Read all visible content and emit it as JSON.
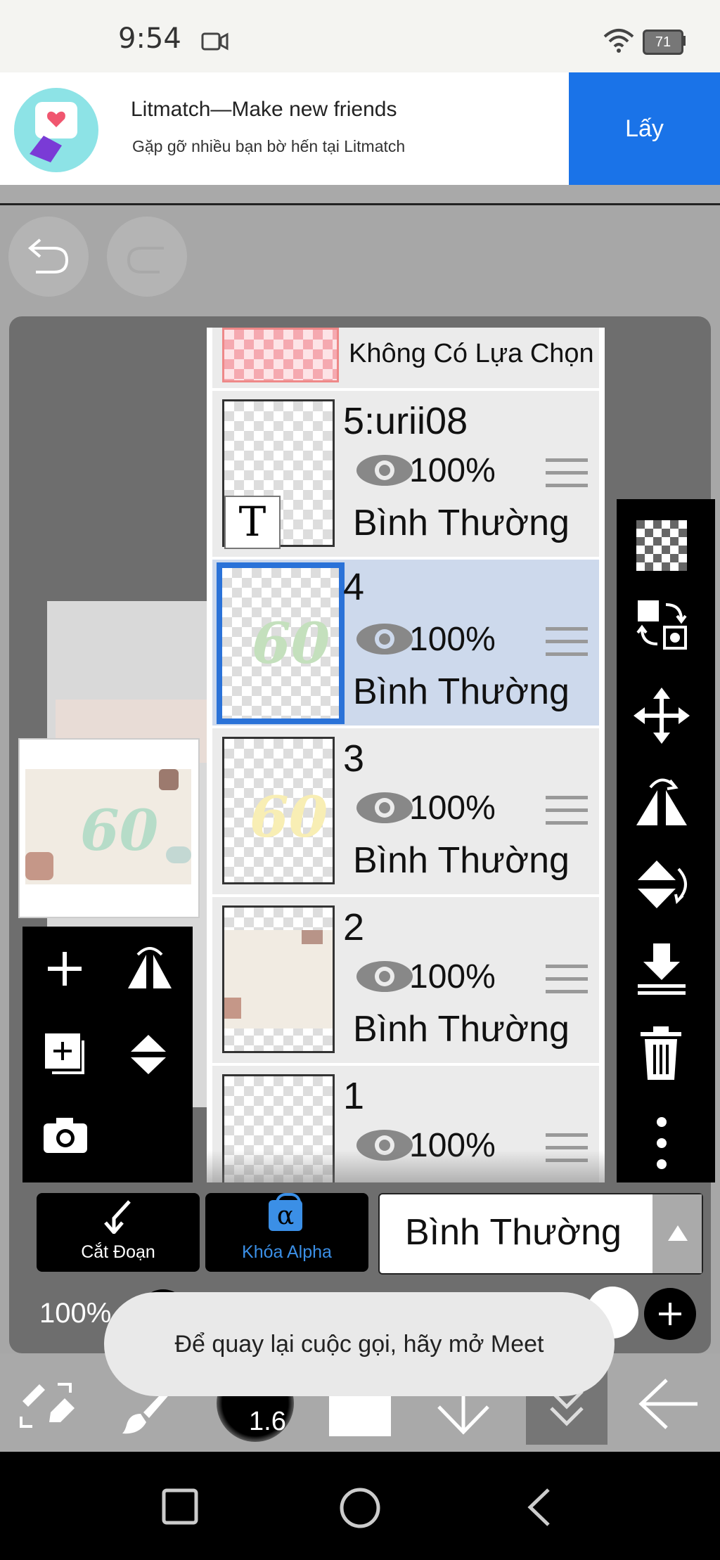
{
  "status": {
    "time": "9:54",
    "battery": "71"
  },
  "ad": {
    "title": "Litmatch—Make new friends",
    "subtitle": "Gặp gỡ nhiều bạn bờ hến tại Litmatch",
    "button": "Lấy"
  },
  "layers": {
    "selection_label": "Không Có Lựa Chọn",
    "items": [
      {
        "name": "5:urii08",
        "opacity": "100%",
        "mode": "Bình Thường"
      },
      {
        "name": "4",
        "opacity": "100%",
        "mode": "Bình Thường"
      },
      {
        "name": "3",
        "opacity": "100%",
        "mode": "Bình Thường"
      },
      {
        "name": "2",
        "opacity": "100%",
        "mode": "Bình Thường"
      },
      {
        "name": "1",
        "opacity": "100%",
        "mode": ""
      }
    ]
  },
  "text_layer_glyph": "T",
  "controls": {
    "clip_label": "Cắt Đoạn",
    "alpha_lock_label": "Khóa Alpha",
    "alpha_symbol": "α",
    "blend_mode": "Bình Thường",
    "opacity_value": "100%",
    "brush_size": "1.6"
  },
  "toast": "Để quay lại cuộc gọi, hãy mở Meet",
  "colors": {
    "accent": "#1a73e8",
    "selected_row": "#cdd9ec",
    "alpha_blue": "#3b8fe6"
  }
}
